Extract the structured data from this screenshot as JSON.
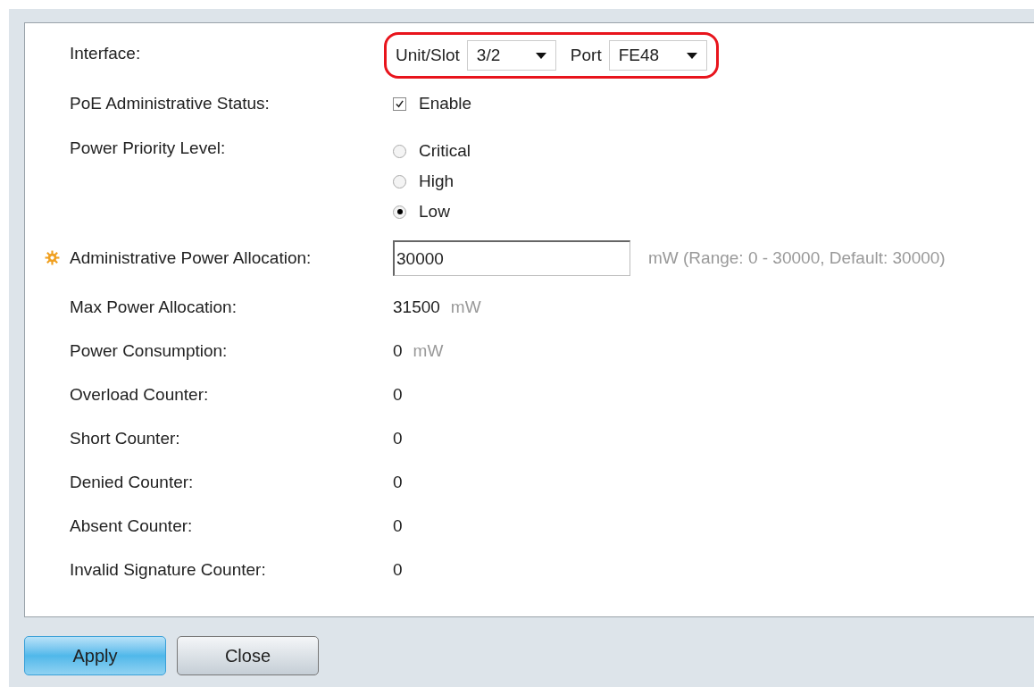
{
  "rows": [
    {
      "kind": "interface",
      "label": "Interface:",
      "highlighted": true,
      "unit_slot": {
        "label": "Unit/Slot",
        "value": "3/2"
      },
      "port": {
        "label": "Port",
        "value": "FE48"
      }
    },
    {
      "kind": "checkbox",
      "label": "PoE Administrative Status:",
      "option": "Enable",
      "checked": true
    },
    {
      "kind": "radio",
      "label": "Power Priority Level:",
      "options": [
        {
          "label": "Critical",
          "selected": false
        },
        {
          "label": "High",
          "selected": false
        },
        {
          "label": "Low",
          "selected": true
        }
      ]
    },
    {
      "kind": "input",
      "label": "Administrative Power Allocation:",
      "required": true,
      "value": "30000",
      "hint": "mW (Range: 0 - 30000, Default: 30000)"
    },
    {
      "kind": "value",
      "label": "Max Power Allocation:",
      "value": "31500",
      "unit": "mW"
    },
    {
      "kind": "value",
      "label": "Power Consumption:",
      "value": "0",
      "unit": "mW"
    },
    {
      "kind": "value",
      "label": "Overload Counter:",
      "value": "0"
    },
    {
      "kind": "value",
      "label": "Short Counter:",
      "value": "0"
    },
    {
      "kind": "value",
      "label": "Denied Counter:",
      "value": "0"
    },
    {
      "kind": "value",
      "label": "Absent Counter:",
      "value": "0"
    },
    {
      "kind": "value",
      "label": "Invalid Signature Counter:",
      "value": "0"
    }
  ],
  "buttons": [
    {
      "label": "Apply",
      "kind": "primary"
    },
    {
      "label": "Close",
      "kind": "secondary"
    }
  ]
}
